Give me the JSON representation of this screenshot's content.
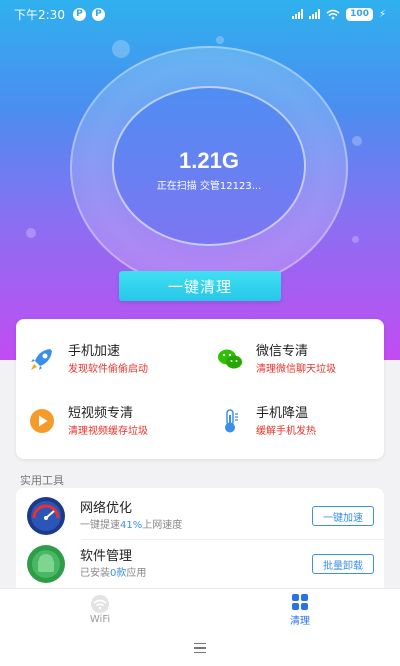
{
  "status_bar": {
    "time": "下午2:30",
    "badge_letter": "P",
    "battery": "100",
    "icons": [
      "p-badge-icon",
      "p-badge-icon",
      "signal-icon",
      "signal-icon",
      "wifi-icon",
      "battery-icon",
      "charging-bolt-icon"
    ]
  },
  "scan": {
    "size": "1.21G",
    "status_text": "正在扫描 交管12123..."
  },
  "clean_button_label": "一键清理",
  "features": [
    {
      "title": "手机加速",
      "subtitle": "发现软件偷偷启动",
      "icon": "rocket-icon"
    },
    {
      "title": "微信专清",
      "subtitle": "清理微信聊天垃圾",
      "icon": "wechat-icon"
    },
    {
      "title": "短视频专清",
      "subtitle": "清理视频缓存垃圾",
      "icon": "video-play-icon"
    },
    {
      "title": "手机降温",
      "subtitle": "缓解手机发热",
      "icon": "thermometer-icon"
    }
  ],
  "tools_section": {
    "label": "实用工具",
    "items": [
      {
        "title": "网络优化",
        "subtitle_prefix": "一键提速",
        "subtitle_value": "41%",
        "subtitle_suffix": "上网速度",
        "button": "一键加速",
        "icon": "speedometer-icon"
      },
      {
        "title": "软件管理",
        "subtitle_prefix": "已安装",
        "subtitle_value": "0款",
        "subtitle_suffix": "应用",
        "button": "批量卸载",
        "icon": "android-app-icon"
      }
    ]
  },
  "tab_bar": {
    "tabs": [
      {
        "label": "WiFi",
        "icon": "wifi-icon",
        "active": false
      },
      {
        "label": "清理",
        "icon": "grid-icon",
        "active": true
      }
    ]
  },
  "colors": {
    "accent": "#2a73e6",
    "highlight_red": "#e8322c",
    "clean_button": "#2ecdec",
    "gradient_top": "#2fb1ee",
    "gradient_bottom": "#c24cf2"
  }
}
